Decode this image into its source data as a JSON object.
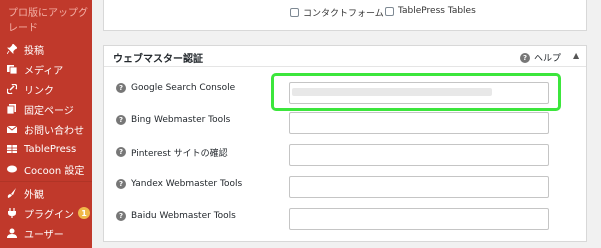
{
  "sidebar": {
    "upgrade_text": "プロ版にアップグレード",
    "items": [
      {
        "label": "投稿",
        "icon": "pin-icon"
      },
      {
        "label": "メディア",
        "icon": "media-icon"
      },
      {
        "label": "リンク",
        "icon": "link-icon"
      },
      {
        "label": "固定ページ",
        "icon": "page-icon"
      },
      {
        "label": "お問い合わせ",
        "icon": "mail-icon"
      },
      {
        "label": "TablePress",
        "icon": "table-icon"
      },
      {
        "label": "Cocoon 設定",
        "icon": "cocoon-icon"
      },
      {
        "label": "外観",
        "icon": "brush-icon"
      },
      {
        "label": "プラグイン",
        "icon": "plugin-icon",
        "badge": "1"
      },
      {
        "label": "ユーザー",
        "icon": "user-icon"
      }
    ]
  },
  "top_panel": {
    "checkbox_contact": "コンタクトフォーム",
    "checkbox_tablepress": "TablePress Tables"
  },
  "webmaster": {
    "title": "ウェブマスター認証",
    "help_label": "ヘルプ",
    "collapse_symbol": "▲",
    "fields": [
      {
        "label": "Google Search Console",
        "value": ""
      },
      {
        "label": "Bing Webmaster Tools",
        "value": ""
      },
      {
        "label": "Pinterest サイトの確認",
        "value": ""
      },
      {
        "label": "Yandex Webmaster Tools",
        "value": ""
      },
      {
        "label": "Baidu Webmaster Tools",
        "value": ""
      }
    ]
  },
  "colors": {
    "sidebar_bg": "#c0392b",
    "highlight": "#3ce63c",
    "badge": "#f0b849"
  }
}
